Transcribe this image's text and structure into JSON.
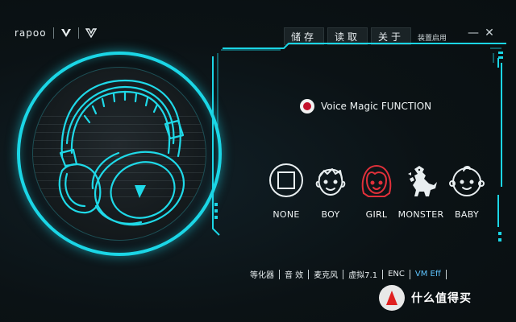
{
  "app": {
    "brand": "rapoo",
    "autostart_label": "装置启用"
  },
  "topnav": {
    "tabs": [
      {
        "label": "储存"
      },
      {
        "label": "读取"
      },
      {
        "label": "关于"
      }
    ]
  },
  "window": {
    "minimize_label": "—",
    "close_label": "✕"
  },
  "voice_magic": {
    "label": "Voice Magic FUNCTION",
    "enabled": true
  },
  "voices": [
    {
      "label": "NONE",
      "icon": "square-icon"
    },
    {
      "label": "BOY",
      "icon": "boy-face-icon"
    },
    {
      "label": "GIRL",
      "icon": "girl-face-icon",
      "selected": true
    },
    {
      "label": "MONSTER",
      "icon": "monster-icon"
    },
    {
      "label": "BABY",
      "icon": "baby-face-icon"
    }
  ],
  "bottom_tabs": [
    {
      "label": "等化器"
    },
    {
      "label": "音 效"
    },
    {
      "label": "麦克风"
    },
    {
      "label": "虚拟7.1"
    },
    {
      "label": "ENC"
    },
    {
      "label": "VM Eff",
      "current": true
    }
  ],
  "watermark": {
    "text": "什么值得买"
  },
  "colors": {
    "accent": "#1bd6e6",
    "selected_voice": "#e0303a",
    "radio_dot": "#c4122c",
    "current_tab": "#5ec4ff"
  }
}
